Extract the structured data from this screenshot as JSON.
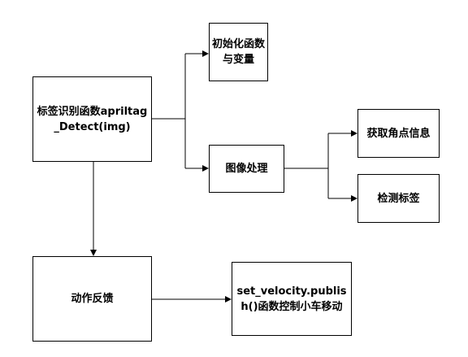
{
  "nodes": {
    "tag_detect": "标签识别函数apriltag_Detect(img)",
    "init_func": "初始化函数与变量",
    "image_proc": "图像处理",
    "get_corners": "获取角点信息",
    "detect_tag": "检测标签",
    "action_feedback": "动作反馈",
    "set_velocity": "set_velocity.publish()函数控制小车移动"
  }
}
